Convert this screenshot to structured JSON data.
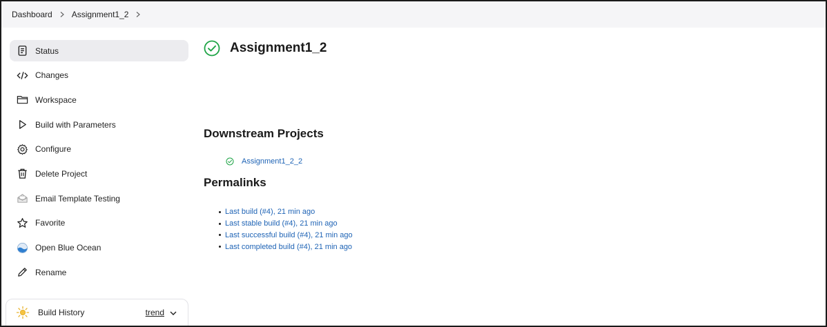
{
  "breadcrumb": {
    "items": [
      "Dashboard",
      "Assignment1_2"
    ]
  },
  "sidebar": {
    "items": [
      {
        "label": "Status",
        "icon": "status-document-icon",
        "active": true
      },
      {
        "label": "Changes",
        "icon": "code-brackets-icon"
      },
      {
        "label": "Workspace",
        "icon": "folder-icon"
      },
      {
        "label": "Build with Parameters",
        "icon": "play-icon"
      },
      {
        "label": "Configure",
        "icon": "gear-icon"
      },
      {
        "label": "Delete Project",
        "icon": "trash-icon"
      },
      {
        "label": "Email Template Testing",
        "icon": "email-icon"
      },
      {
        "label": "Favorite",
        "icon": "star-icon"
      },
      {
        "label": "Open Blue Ocean",
        "icon": "blue-ocean-icon"
      },
      {
        "label": "Rename",
        "icon": "pencil-icon"
      }
    ]
  },
  "build_history": {
    "label": "Build History",
    "trend_label": "trend",
    "icon": "sun-icon"
  },
  "main": {
    "title": "Assignment1_2",
    "status_icon": "success-check-icon",
    "downstream_title": "Downstream Projects",
    "downstream": [
      {
        "label": "Assignment1_2_2"
      }
    ],
    "permalinks_title": "Permalinks",
    "permalinks": [
      "Last build (#4), 21 min ago",
      "Last stable build (#4), 21 min ago",
      "Last successful build (#4), 21 min ago",
      "Last completed build (#4), 21 min ago"
    ]
  },
  "colors": {
    "success": "#1ea446",
    "link": "#1e63b5",
    "active_bg": "#ececef",
    "breadcrumb_bg": "#f5f5f7"
  }
}
